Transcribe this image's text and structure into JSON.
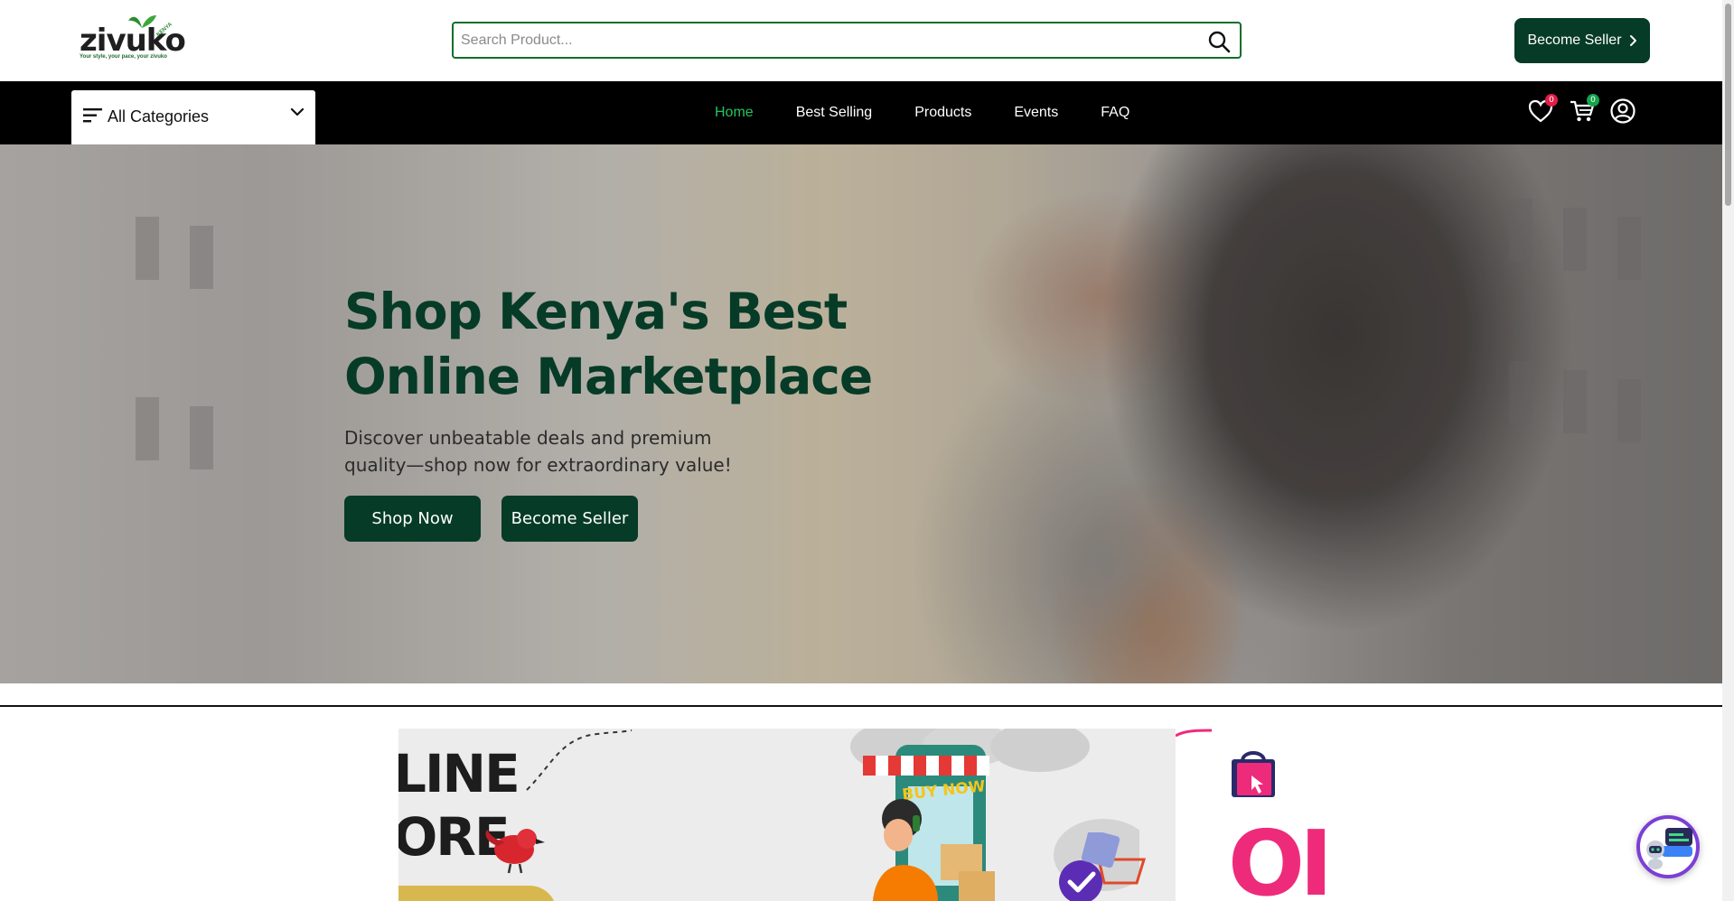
{
  "header": {
    "logo": {
      "word": "zivuko",
      "tagline": "Your style, your pace, your zivuko",
      "country": "KENYA"
    },
    "search": {
      "placeholder": "Search Product..."
    },
    "become_seller_label": "Become Seller"
  },
  "nav": {
    "categories_label": "All Categories",
    "links": [
      {
        "label": "Home",
        "active": true
      },
      {
        "label": "Best Selling",
        "active": false
      },
      {
        "label": "Products",
        "active": false
      },
      {
        "label": "Events",
        "active": false
      },
      {
        "label": "FAQ",
        "active": false
      }
    ],
    "wishlist_count": "0",
    "cart_count": "0"
  },
  "hero": {
    "title_line1": "Shop Kenya's Best",
    "title_line2": "Online Marketplace",
    "subtitle": "Discover unbeatable deals and premium quality—shop now for extraordinary value!",
    "shop_now_label": "Shop Now",
    "become_seller_label": "Become Seller"
  },
  "banner": {
    "line1": "LINE",
    "line2": "ORE",
    "sign": "BUY NOW",
    "right_text": "OI"
  },
  "colors": {
    "brand_dark_green": "#063b27",
    "active_link_green": "#22c55e",
    "wishlist_badge": "#e11d48",
    "cart_badge": "#16a34a",
    "banner_pink": "#ee2b7a",
    "chat_ring": "#7b3fd6"
  },
  "icons": [
    "search-icon",
    "chevron-right-icon",
    "menu-icon",
    "chevron-down-icon",
    "heart-icon",
    "cart-icon",
    "user-icon",
    "shopping-bag-icon",
    "chatbot-icon"
  ]
}
